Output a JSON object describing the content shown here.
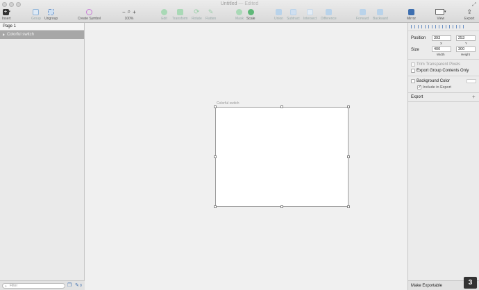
{
  "window": {
    "title": "Untitled",
    "separator": "—",
    "status": "Edited"
  },
  "toolbar": {
    "insert": "Insert",
    "group": "Group",
    "ungroup": "Ungroup",
    "create_symbol": "Create Symbol",
    "zoom_minus": "−",
    "zoom_plus": "+",
    "zoom_level": "100%",
    "edit": "Edit",
    "transform": "Transform",
    "rotate": "Rotate",
    "flatten": "Flatten",
    "mask": "Mask",
    "scale": "Scale",
    "union": "Union",
    "subtract": "Subtract",
    "intersect": "Intersect",
    "difference": "Difference",
    "forward": "Forward",
    "backward": "Backward",
    "mirror": "Mirror",
    "view": "View",
    "export": "Export"
  },
  "layers": {
    "page_label": "Page 1",
    "items": [
      {
        "label": "Colorful switch"
      }
    ],
    "filter_placeholder": "Filter",
    "count": "0"
  },
  "canvas": {
    "artboard_label": "Colorful switch"
  },
  "inspector": {
    "position_label": "Position",
    "x_value": "393",
    "y_value": "253",
    "x_label": "X",
    "y_label": "Y",
    "size_label": "Size",
    "width_value": "400",
    "height_value": "300",
    "width_label": "Width",
    "height_label": "Height",
    "trim_transparent": "Trim Transparent Pixels",
    "export_group": "Export Group Contents Only",
    "background_color": "Background Color",
    "include_in_export": "Include in Export",
    "export_header": "Export",
    "export_add": "+",
    "make_exportable": "Make Exportable",
    "badge": "3"
  },
  "colors": {
    "accent": "#5fb878",
    "symbol": "#c87bd6",
    "align": "#6a8fc2"
  }
}
